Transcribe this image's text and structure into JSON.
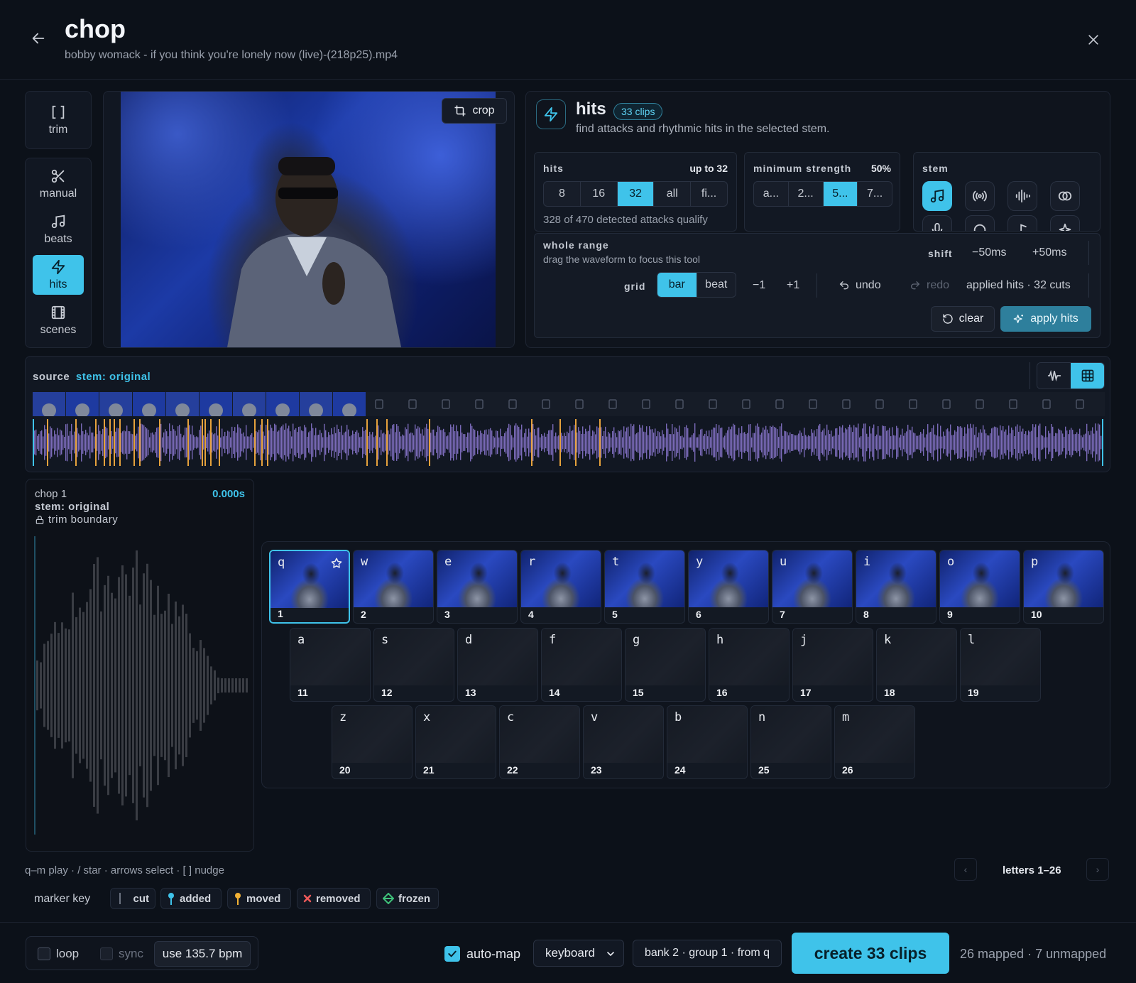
{
  "header": {
    "title": "chop",
    "subtitle": "bobby womack - if you think you're lonely now (live)-(218p25).mp4"
  },
  "tools": {
    "trim": "trim",
    "manual": "manual",
    "beats": "beats",
    "hits": "hits",
    "scenes": "scenes"
  },
  "video": {
    "crop_label": "crop"
  },
  "hits_panel": {
    "title": "hits",
    "badge": "33 clips",
    "description": "find attacks and rhythmic hits in the selected stem.",
    "hits": {
      "label": "hits",
      "value": "up to 32",
      "options": [
        "8",
        "16",
        "32",
        "all",
        "fi..."
      ],
      "selected": "32",
      "note": "328 of 470 detected attacks qualify"
    },
    "strength": {
      "label": "minimum strength",
      "value": "50%",
      "options": [
        "a...",
        "2...",
        "5...",
        "7..."
      ],
      "selected": "5..."
    },
    "stem": {
      "label": "stem"
    },
    "range": {
      "title": "whole range",
      "hint": "drag the waveform to focus this tool",
      "shift_label": "shift",
      "shift_minus": "−50ms",
      "shift_plus": "+50ms",
      "grid_label": "grid",
      "grid_bar": "bar",
      "grid_beat": "beat",
      "minus_one": "−1",
      "plus_one": "+1",
      "undo": "undo",
      "redo": "redo",
      "status": "applied hits · 32 cuts",
      "clear": "clear",
      "apply": "apply hits"
    }
  },
  "source": {
    "label": "source",
    "stem": "stem: original"
  },
  "chop": {
    "title": "chop 1",
    "stem": "stem: original",
    "lock_label": "trim boundary",
    "time": "0.000s"
  },
  "keys": {
    "row1": [
      {
        "letter": "q",
        "num": "1"
      },
      {
        "letter": "w",
        "num": "2"
      },
      {
        "letter": "e",
        "num": "3"
      },
      {
        "letter": "r",
        "num": "4"
      },
      {
        "letter": "t",
        "num": "5"
      },
      {
        "letter": "y",
        "num": "6"
      },
      {
        "letter": "u",
        "num": "7"
      },
      {
        "letter": "i",
        "num": "8"
      },
      {
        "letter": "o",
        "num": "9"
      },
      {
        "letter": "p",
        "num": "10"
      }
    ],
    "row2": [
      {
        "letter": "a",
        "num": "11"
      },
      {
        "letter": "s",
        "num": "12"
      },
      {
        "letter": "d",
        "num": "13"
      },
      {
        "letter": "f",
        "num": "14"
      },
      {
        "letter": "g",
        "num": "15"
      },
      {
        "letter": "h",
        "num": "16"
      },
      {
        "letter": "j",
        "num": "17"
      },
      {
        "letter": "k",
        "num": "18"
      },
      {
        "letter": "l",
        "num": "19"
      }
    ],
    "row3": [
      {
        "letter": "z",
        "num": "20"
      },
      {
        "letter": "x",
        "num": "21"
      },
      {
        "letter": "c",
        "num": "22"
      },
      {
        "letter": "v",
        "num": "23"
      },
      {
        "letter": "b",
        "num": "24"
      },
      {
        "letter": "n",
        "num": "25"
      },
      {
        "letter": "m",
        "num": "26"
      }
    ]
  },
  "help": "q–m play · / star · arrows select · [ ] nudge",
  "pager": {
    "label": "letters 1–26"
  },
  "marker_key": {
    "label": "marker key",
    "items": [
      "cut",
      "added",
      "moved",
      "removed",
      "frozen"
    ]
  },
  "footer": {
    "loop": "loop",
    "sync": "sync",
    "bpm_button": "use 135.7 bpm",
    "automap": "auto-map",
    "mode_select": "keyboard",
    "bank": "bank 2 · group 1 · from q",
    "create": "create 33 clips",
    "status": "26 mapped · 7 unmapped"
  },
  "colors": {
    "accent": "#3fc3ea",
    "waveform": "#7a6ab8",
    "hit_marker": "#e6a23c",
    "background": "#0c1119"
  }
}
